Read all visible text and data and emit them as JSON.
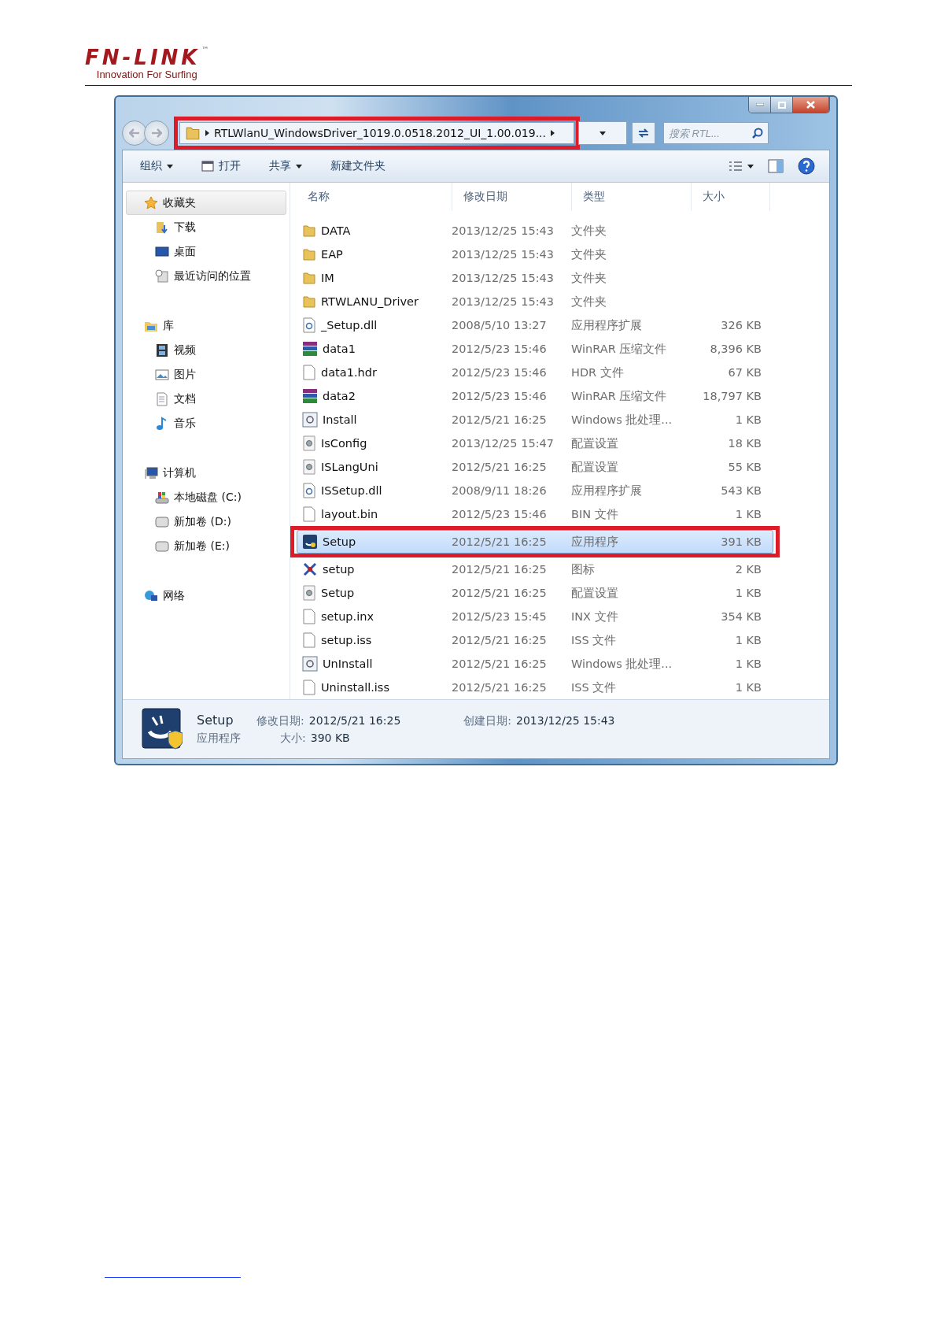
{
  "header": {
    "logo": "FN-LINK",
    "trademark": "™",
    "tagline": "Innovation For Surfing"
  },
  "window": {
    "address": {
      "crumb": "RTLWlanU_WindowsDriver_1019.0.0518.2012_UI_1.00.019...",
      "highlighted": true
    },
    "search": {
      "placeholder": "搜索 RTL..."
    }
  },
  "toolbar": [
    {
      "label": "组织",
      "dropdown": true,
      "kind": "text"
    },
    {
      "label": "打开",
      "dropdown": false,
      "kind": "open"
    },
    {
      "label": "共享",
      "dropdown": true,
      "kind": "text"
    },
    {
      "label": "新建文件夹",
      "dropdown": false,
      "kind": "text"
    }
  ],
  "sidebar": [
    {
      "label": "收藏夹",
      "kind": "star",
      "selected": true,
      "children": [
        {
          "label": "下载",
          "kind": "download"
        },
        {
          "label": "桌面",
          "kind": "desktop"
        },
        {
          "label": "最近访问的位置",
          "kind": "recent"
        }
      ]
    },
    {
      "label": "库",
      "kind": "library",
      "selected": false,
      "children": [
        {
          "label": "视频",
          "kind": "video"
        },
        {
          "label": "图片",
          "kind": "picture"
        },
        {
          "label": "文档",
          "kind": "document"
        },
        {
          "label": "音乐",
          "kind": "music"
        }
      ]
    },
    {
      "label": "计算机",
      "kind": "computer",
      "selected": false,
      "children": [
        {
          "label": "本地磁盘 (C:)",
          "kind": "systemdrive"
        },
        {
          "label": "新加卷 (D:)",
          "kind": "drive"
        },
        {
          "label": "新加卷 (E:)",
          "kind": "drive"
        }
      ]
    },
    {
      "label": "网络",
      "kind": "network",
      "selected": false
    }
  ],
  "table": {
    "columns": [
      "名称",
      "修改日期",
      "类型",
      "大小"
    ],
    "rows": [
      {
        "name": "DATA",
        "date": "2013/12/25 15:43",
        "type": "文件夹",
        "kind": "folder",
        "selected": false,
        "highlighted": false
      },
      {
        "name": "EAP",
        "date": "2013/12/25 15:43",
        "type": "文件夹",
        "kind": "folder",
        "selected": false,
        "highlighted": false
      },
      {
        "name": "IM",
        "date": "2013/12/25 15:43",
        "type": "文件夹",
        "kind": "folder",
        "selected": false,
        "highlighted": false
      },
      {
        "name": "RTWLANU_Driver",
        "date": "2013/12/25 15:43",
        "type": "文件夹",
        "kind": "folder",
        "selected": false,
        "highlighted": false
      },
      {
        "name": "_Setup.dll",
        "date": "2008/5/10 13:27",
        "type": "应用程序扩展",
        "size": "326 KB",
        "kind": "dll",
        "selected": false,
        "highlighted": false
      },
      {
        "name": "data1",
        "date": "2012/5/23 15:46",
        "type": "WinRAR 压缩文件",
        "size": "8,396 KB",
        "kind": "archive",
        "selected": false,
        "highlighted": false
      },
      {
        "name": "data1.hdr",
        "date": "2012/5/23 15:46",
        "type": "HDR 文件",
        "size": "67 KB",
        "kind": "blank",
        "selected": false,
        "highlighted": false
      },
      {
        "name": "data2",
        "date": "2012/5/23 15:46",
        "type": "WinRAR 压缩文件",
        "size": "18,797 KB",
        "kind": "archive",
        "selected": false,
        "highlighted": false
      },
      {
        "name": "Install",
        "date": "2012/5/21 16:25",
        "type": "Windows 批处理...",
        "size": "1 KB",
        "kind": "batch",
        "selected": false,
        "highlighted": false
      },
      {
        "name": "IsConfig",
        "date": "2013/12/25 15:47",
        "type": "配置设置",
        "size": "18 KB",
        "kind": "config",
        "selected": false,
        "highlighted": false
      },
      {
        "name": "ISLangUni",
        "date": "2012/5/21 16:25",
        "type": "配置设置",
        "size": "55 KB",
        "kind": "config",
        "selected": false,
        "highlighted": false
      },
      {
        "name": "ISSetup.dll",
        "date": "2008/9/11 18:26",
        "type": "应用程序扩展",
        "size": "543 KB",
        "kind": "dll",
        "selected": false,
        "highlighted": false
      },
      {
        "name": "layout.bin",
        "date": "2012/5/23 15:46",
        "type": "BIN 文件",
        "size": "1 KB",
        "kind": "blank",
        "selected": false,
        "highlighted": false
      },
      {
        "name": "Setup",
        "date": "2012/5/21 16:25",
        "type": "应用程序",
        "size": "391 KB",
        "kind": "program",
        "selected": true,
        "highlighted": true
      },
      {
        "name": "setup",
        "date": "2012/5/21 16:25",
        "type": "图标",
        "size": "2 KB",
        "kind": "iconfile",
        "selected": false,
        "highlighted": false
      },
      {
        "name": "Setup",
        "date": "2012/5/21 16:25",
        "type": "配置设置",
        "size": "1 KB",
        "kind": "config",
        "selected": false,
        "highlighted": false
      },
      {
        "name": "setup.inx",
        "date": "2012/5/23 15:45",
        "type": "INX 文件",
        "size": "354 KB",
        "kind": "blank",
        "selected": false,
        "highlighted": false
      },
      {
        "name": "setup.iss",
        "date": "2012/5/21 16:25",
        "type": "ISS 文件",
        "size": "1 KB",
        "kind": "blank",
        "selected": false,
        "highlighted": false
      },
      {
        "name": "UnInstall",
        "date": "2012/5/21 16:25",
        "type": "Windows 批处理...",
        "size": "1 KB",
        "kind": "batch",
        "selected": false,
        "highlighted": false
      },
      {
        "name": "Uninstall.iss",
        "date": "2012/5/21 16:25",
        "type": "ISS 文件",
        "size": "1 KB",
        "kind": "blank",
        "selected": false,
        "highlighted": false
      }
    ]
  },
  "details": {
    "name": "Setup",
    "type": "应用程序",
    "modified_label": "修改日期:",
    "modified": "2012/5/21 16:25",
    "size_label": "大小:",
    "size": "390 KB",
    "created_label": "创建日期:",
    "created": "2013/12/25 15:43"
  }
}
